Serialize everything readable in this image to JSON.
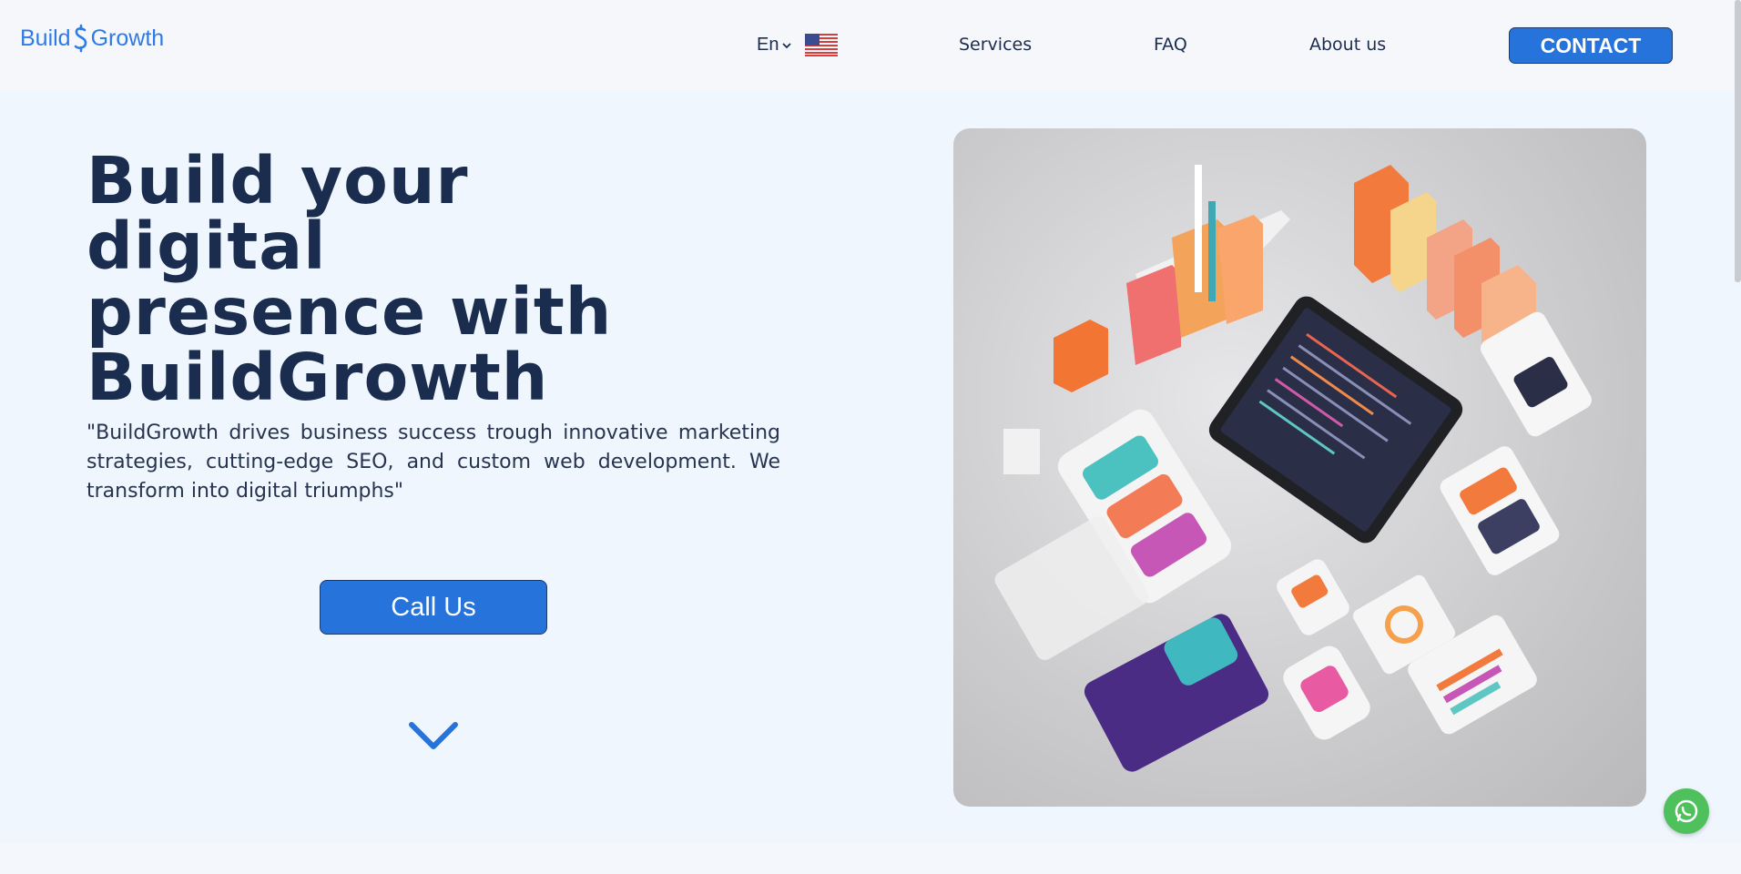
{
  "header": {
    "logo_text_left": "Build",
    "logo_text_right": "Growth",
    "language": "En",
    "flag_icon": "us-flag-icon",
    "nav": {
      "services": "Services",
      "faq": "FAQ",
      "about": "About us"
    },
    "contact_label": "CONTACT"
  },
  "hero": {
    "title_line1": "Build your digital",
    "title_line2": "presence with",
    "title_line3": "BuildGrowth",
    "description": "\"BuildGrowth drives business success trough innovative marketing strategies, cutting-edge SEO, and custom web development. We transform into digital triumphs\"",
    "call_label": "Call Us",
    "scroll_icon": "chevron-down-icon"
  },
  "floating": {
    "whatsapp_icon": "whatsapp-icon"
  },
  "colors": {
    "accent": "#2673db",
    "text_dark": "#1b2d4f",
    "whatsapp": "#4ec05c"
  }
}
